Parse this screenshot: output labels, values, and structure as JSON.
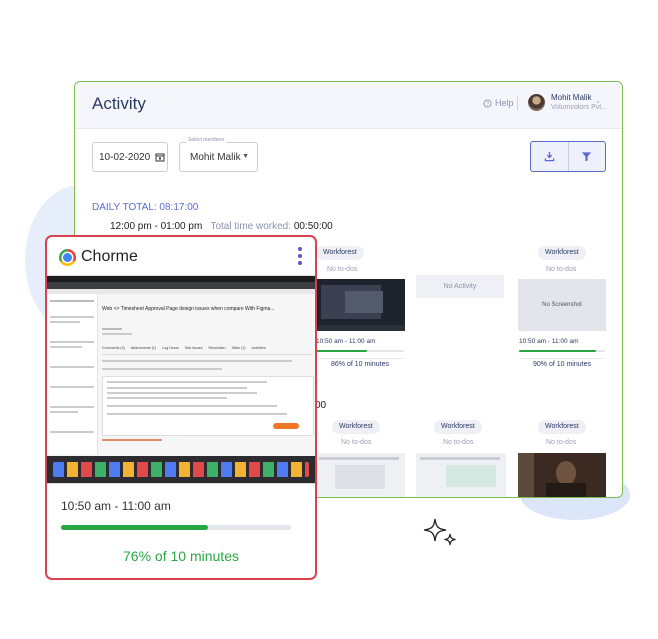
{
  "activity_panel": {
    "title": "Activity",
    "help_label": "Help",
    "user": {
      "name": "Mohit Malik",
      "company": "Volumcolors Pvt..."
    },
    "date_filter": "10-02-2020",
    "member_select": {
      "label": "Select members",
      "value": "Mohit Malik"
    },
    "daily_total": "DAILY TOTAL: 08:17:00",
    "slot": {
      "range": "12:00 pm - 01:00 pm",
      "worked_label": "Total time worked:",
      "worked_value": "00:50:00"
    },
    "slot2_fragment": "00",
    "row1": [
      {
        "project": "Workforest",
        "todo": "No to-dos",
        "time": "10:50 am - 11:00 am",
        "percent_label": "86% of 10 minutes",
        "percent": 86
      },
      {
        "no_activity": "No Activity"
      },
      {
        "project": "Workforest",
        "todo": "No to-dos",
        "screenshot_text": "No Screenshot",
        "time": "10:50 am - 11:00 am",
        "percent_label": "90% of 10 minutes",
        "percent": 90
      }
    ],
    "row2": [
      {
        "project": "Workforest",
        "todo": "No to-dos"
      },
      {
        "project": "Workforest",
        "todo": "No to-dos"
      },
      {
        "project": "Workforest",
        "todo": "No to-dos"
      }
    ]
  },
  "popup": {
    "app_name": "Chorme",
    "time": "10:50 am - 11:00 am",
    "percent_label": "76% of 10 minutes",
    "percent": 76,
    "screen": {
      "page_title": "Web <> Timesheet Approval Page design issues when compare With Figma...",
      "tabs": [
        "Comments (4)",
        "Attachments (1)",
        "Log Hours",
        "Sub Issues",
        "Resolution",
        "Table (1)",
        "Activities"
      ]
    }
  },
  "colors": {
    "accent": "#5a6bcf",
    "success": "#27a844",
    "popup_border": "#d8434f",
    "panel_border": "#7cbd4e"
  }
}
